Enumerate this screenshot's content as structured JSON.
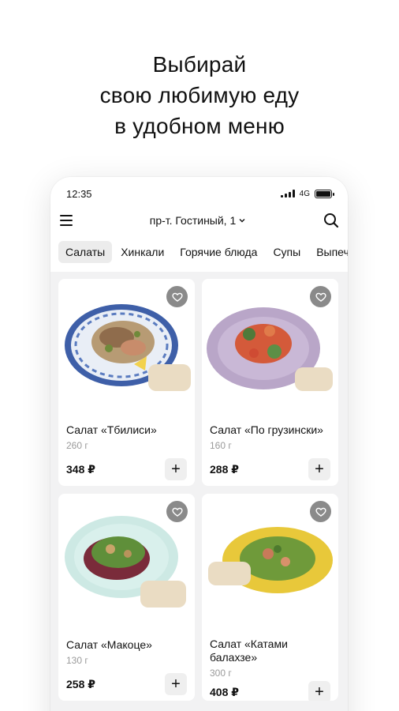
{
  "headline": {
    "line1": "Выбирай",
    "line2": "свою любимую еду",
    "line3": "в удобном меню"
  },
  "status_bar": {
    "time": "12:35",
    "network": "4G"
  },
  "header": {
    "address": "пр-т. Гостиный, 1"
  },
  "tabs": [
    {
      "label": "Салаты",
      "active": true
    },
    {
      "label": "Хинкали",
      "active": false
    },
    {
      "label": "Горячие блюда",
      "active": false
    },
    {
      "label": "Супы",
      "active": false
    },
    {
      "label": "Выпечка",
      "active": false
    }
  ],
  "products": [
    {
      "name": "Салат «Тбилиси»",
      "weight": "260 г",
      "price": "348 ₽",
      "add_label": "+"
    },
    {
      "name": "Салат «По грузински»",
      "weight": "160 г",
      "price": "288 ₽",
      "add_label": "+"
    },
    {
      "name": "Салат «Макоце»",
      "weight": "130 г",
      "price": "258 ₽",
      "add_label": "+"
    },
    {
      "name": "Салат «Катами балахзе»",
      "weight": "300 г",
      "price": "408 ₽",
      "add_label": "+"
    }
  ],
  "icons": {
    "menu": "hamburger-icon",
    "search": "search-icon",
    "favorite": "heart-icon",
    "dropdown": "chevron-down-icon"
  },
  "colors": {
    "active_tab_bg": "#ececec",
    "favorite_bg": "#8a8a8a",
    "weight_text": "#9a9a9a"
  }
}
